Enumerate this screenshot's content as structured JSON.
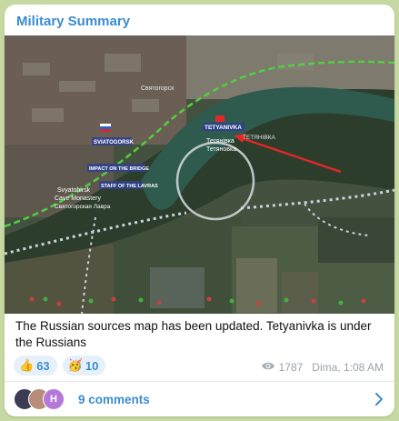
{
  "post": {
    "channel_name": "Military Summary",
    "caption": "The Russian sources map has been updated. Tetyanivka is under the Russians",
    "map": {
      "labels": [
        {
          "name": "tetyanivka-flag-label",
          "text": "TETYANIVKA"
        },
        {
          "name": "tetyanivka-ua-label",
          "text": "Тетянівка"
        },
        {
          "name": "tetyanivka-ru-label",
          "text": "Тетяновка"
        },
        {
          "name": "tetyanivka-caps-label",
          "text": "ТЕТЯНІВКА"
        },
        {
          "name": "sviatohirsk-label",
          "text": "SVIATOGORSK"
        },
        {
          "name": "svyatohirsk-label",
          "text": "Святогорск"
        },
        {
          "name": "impact-label",
          "text": "IMPACT ON THE BRIDGE"
        },
        {
          "name": "staff-label",
          "text": "STAFF OF THE LAVRAS"
        },
        {
          "name": "svyatohirsk-lavra-label",
          "text": "Svyatohirsk"
        },
        {
          "name": "cave-monastery-label",
          "text": "Cave Monastery"
        },
        {
          "name": "lavra-label",
          "text": "Святогорская Лавра"
        }
      ],
      "colors": {
        "frontline": "#4fd040",
        "arrow": "#e02828",
        "river": "#2f5a4e",
        "road": "#c9d3dc"
      }
    },
    "reactions": [
      {
        "icon": "thumbs-up-icon",
        "emoji": "👍",
        "count": "63"
      },
      {
        "icon": "party-icon",
        "emoji": "🥳",
        "count": "10"
      }
    ],
    "views": "1787",
    "author": "Dima, 1:08 AM",
    "comments": {
      "label": "9 comments",
      "avatar_letter": "H"
    }
  }
}
